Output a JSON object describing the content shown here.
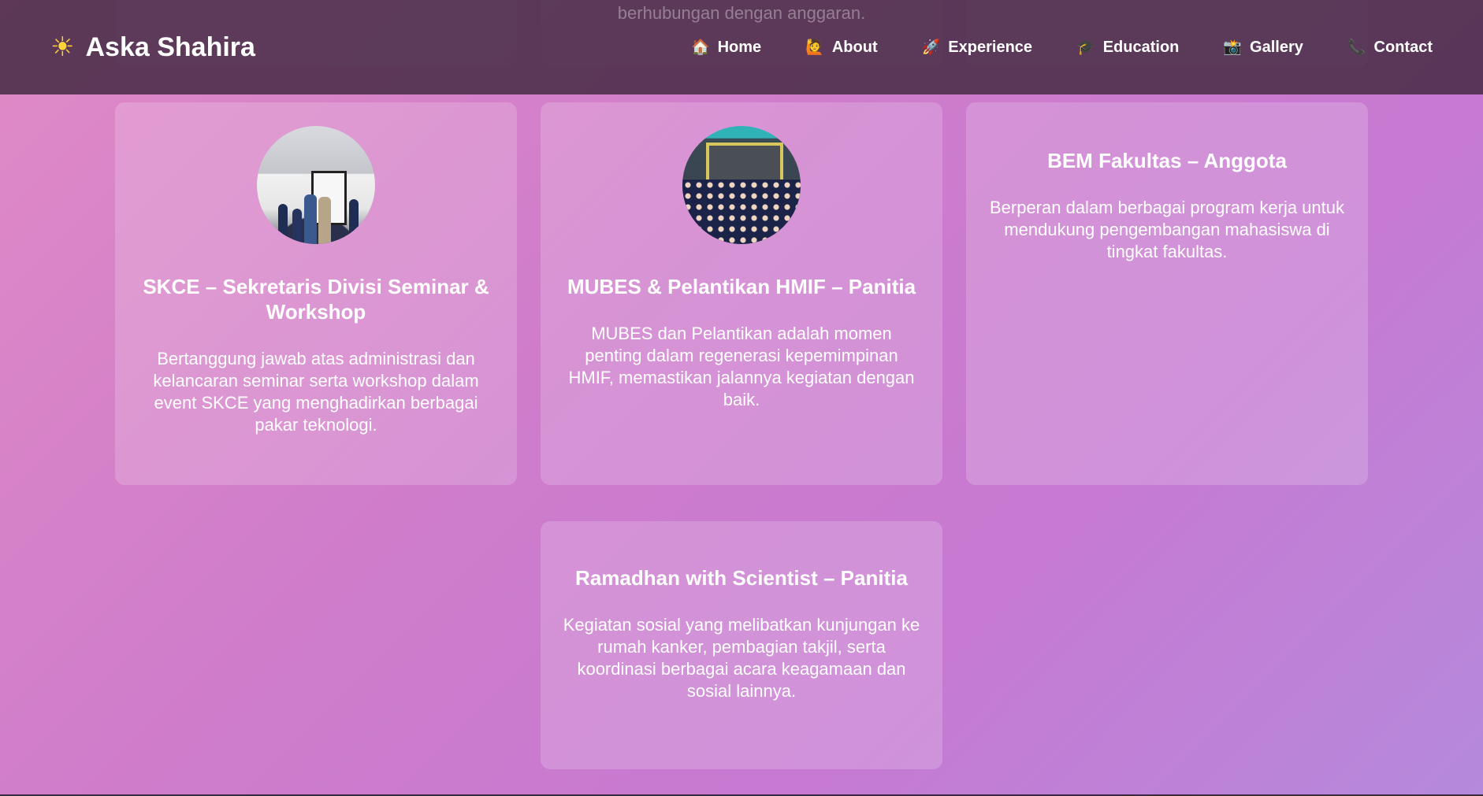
{
  "header": {
    "brand": "Aska Shahira",
    "brand_icon": "sun-icon",
    "nav": [
      {
        "label": "Home",
        "icon": "house-icon",
        "glyph": "🏠"
      },
      {
        "label": "About",
        "icon": "person-raising-hand-icon",
        "glyph": "🙋"
      },
      {
        "label": "Experience",
        "icon": "rocket-icon",
        "glyph": "🚀"
      },
      {
        "label": "Education",
        "icon": "graduation-cap-icon",
        "glyph": "🎓"
      },
      {
        "label": "Gallery",
        "icon": "camera-icon",
        "glyph": "📸"
      },
      {
        "label": "Contact",
        "icon": "telephone-icon",
        "glyph": "📞"
      }
    ]
  },
  "partial_text": "berhubungan dengan anggaran.",
  "cards": [
    {
      "title": "SKCE – Sekretaris Divisi Seminar & Workshop",
      "description": "Bertanggung jawab atas administrasi dan kelancaran seminar serta workshop dalam event SKCE yang menghadirkan berbagai pakar teknologi."
    },
    {
      "title": "MUBES & Pelantikan HMIF – Panitia",
      "description": "MUBES dan Pelantikan adalah momen penting dalam regenerasi kepemimpinan HMIF, memastikan jalannya kegiatan dengan baik."
    },
    {
      "title": "BEM Fakultas – Anggota",
      "description": "Berperan dalam berbagai program kerja untuk mendukung pengembangan mahasiswa di tingkat fakultas."
    },
    {
      "title": "Ramadhan with Scientist – Panitia",
      "description": "Kegiatan sosial yang melibatkan kunjungan ke rumah kanker, pembagian takjil, serta koordinasi berbagai acara keagamaan dan sosial lainnya."
    }
  ]
}
